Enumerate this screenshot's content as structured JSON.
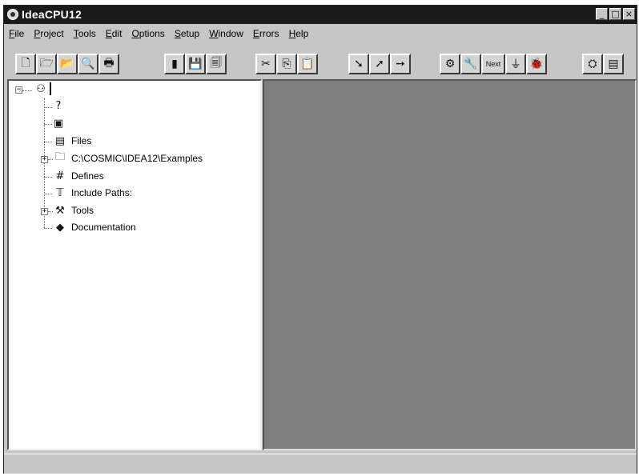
{
  "window": {
    "title": "IdeaCPU12",
    "controls": [
      {
        "name": "minimize",
        "glyph": "_"
      },
      {
        "name": "maximize",
        "glyph": "□"
      },
      {
        "name": "close",
        "glyph": "×"
      }
    ]
  },
  "menu": [
    "File",
    "Project",
    "Tools",
    "Edit",
    "Options",
    "Setup",
    "Window",
    "Errors",
    "Help"
  ],
  "toolbar": {
    "buttons": [
      {
        "icon": "new-file-icon",
        "glyph": "🗋"
      },
      {
        "icon": "open-project-icon",
        "glyph": "🗁"
      },
      {
        "icon": "open-file-icon",
        "glyph": "📂"
      },
      {
        "icon": "find-icon",
        "glyph": "🔍"
      },
      {
        "icon": "print-icon",
        "glyph": "🖶"
      },
      {
        "icon": "black-file-icon",
        "glyph": "▮"
      },
      {
        "icon": "save-icon",
        "glyph": "💾"
      },
      {
        "icon": "save-all-icon",
        "glyph": "🗐"
      },
      {
        "icon": "cut-icon",
        "glyph": "✂"
      },
      {
        "icon": "copy-icon",
        "glyph": "⎘"
      },
      {
        "icon": "paste-icon",
        "glyph": "📋"
      },
      {
        "icon": "compile-icon",
        "glyph": "➘"
      },
      {
        "icon": "build-icon",
        "glyph": "➚"
      },
      {
        "icon": "make-icon",
        "glyph": "➙"
      },
      {
        "icon": "settings-icon",
        "glyph": "⚙"
      },
      {
        "icon": "tool-icon",
        "glyph": "🔧"
      },
      {
        "icon": "next-label",
        "glyph": "Next"
      },
      {
        "icon": "filter-icon",
        "glyph": "⏚"
      },
      {
        "icon": "debug-icon",
        "glyph": "🐞"
      },
      {
        "icon": "run-icon",
        "glyph": "⛭"
      },
      {
        "icon": "stop-icon",
        "glyph": "▤"
      }
    ]
  },
  "tree": {
    "root_icon": "project-icon",
    "items": [
      {
        "icon": "help-icon",
        "glyph": "?",
        "label": ""
      },
      {
        "icon": "target-icon",
        "glyph": "▣",
        "label": ""
      },
      {
        "icon": "files-icon",
        "glyph": "▤",
        "label": "Files"
      },
      {
        "icon": "folder-icon",
        "glyph": "🗀",
        "label": "C:\\COSMIC\\IDEA12\\Examples"
      },
      {
        "icon": "hash-icon",
        "glyph": "#",
        "label": "Defines"
      },
      {
        "icon": "include-paths-icon",
        "glyph": "𝕋",
        "label": "Include Paths:"
      },
      {
        "icon": "tools-icon",
        "glyph": "⚒",
        "label": "Tools"
      },
      {
        "icon": "documentation-icon",
        "glyph": "◆",
        "label": "Documentation"
      }
    ]
  },
  "colors": {
    "title_bar": "#1a1a1a",
    "workspace": "#7f7f7f",
    "chrome": "#c6c6c6"
  }
}
